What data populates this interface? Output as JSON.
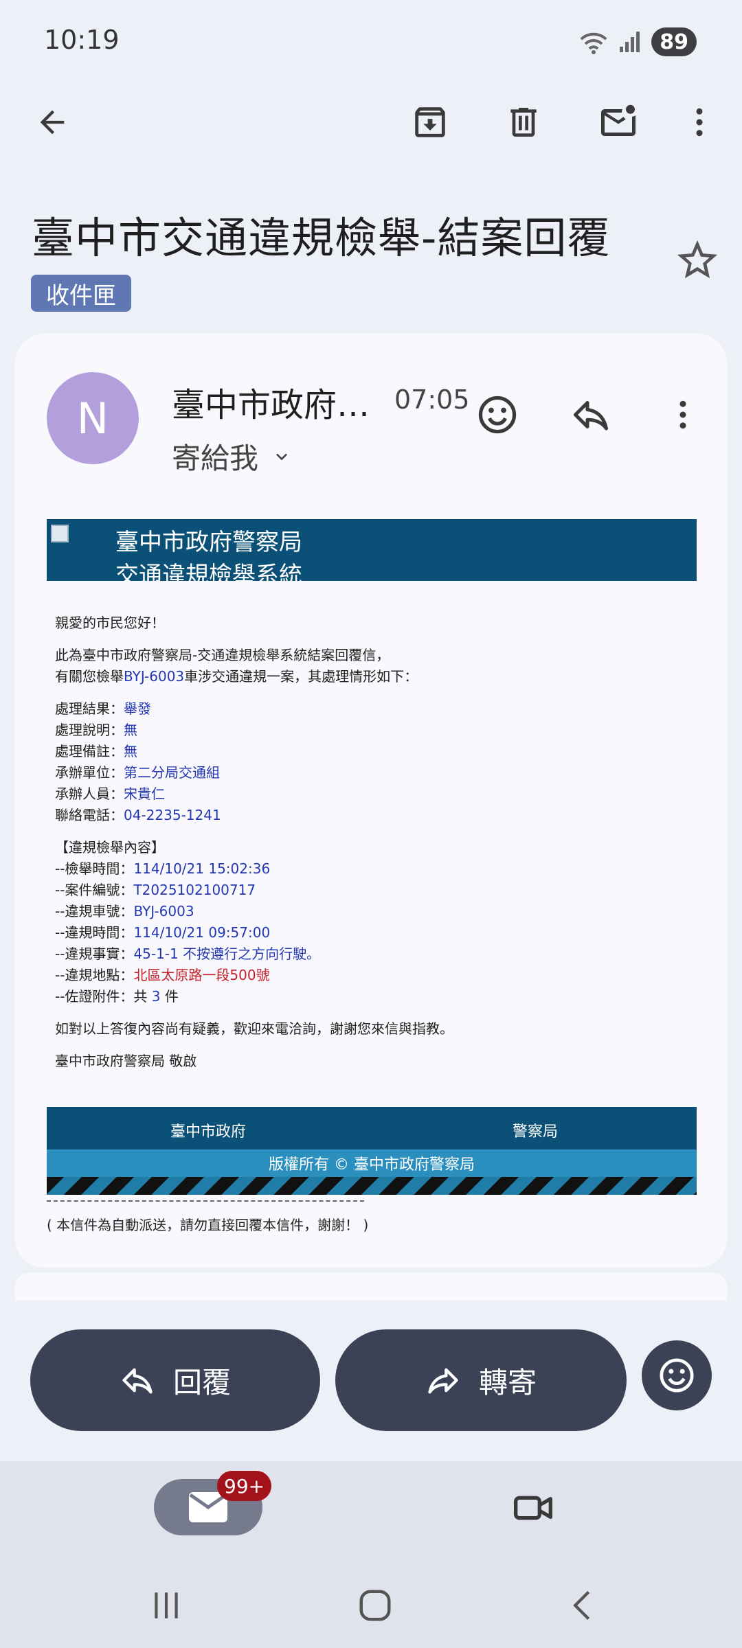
{
  "status_bar": {
    "time": "10:19",
    "battery": "89",
    "signal_label": "5"
  },
  "subject": "臺中市交通違規檢舉-結案回覆",
  "label": "收件匣",
  "message": {
    "avatar_letter": "N",
    "sender": "臺中市政府…",
    "time": "07:05",
    "to": "寄給我"
  },
  "email": {
    "header_line1": "臺中市政府警察局",
    "header_line2": "交通違規檢舉系統",
    "greeting": "親愛的市民您好！",
    "intro1": "此為臺中市政府警察局-交通違規檢舉系統結案回覆信，",
    "intro2_a": "有關您檢舉",
    "intro2_plate": "BYJ-6003",
    "intro2_b": "車涉交通違規一案，其處理情形如下：",
    "result_rows": [
      {
        "label": "處理結果：",
        "value": "舉發"
      },
      {
        "label": "處理說明：",
        "value": "無"
      },
      {
        "label": "處理備註：",
        "value": "無"
      },
      {
        "label": "承辦單位：",
        "value": "第二分局交通組"
      },
      {
        "label": "承辦人員：",
        "value": "宋貴仁"
      },
      {
        "label": "聯絡電話：",
        "value": "04-2235-1241"
      }
    ],
    "section_title": "【違規檢舉內容】",
    "detail_rows": [
      {
        "label": "--檢舉時間：",
        "value": "114/10/21 15:02:36"
      },
      {
        "label": "--案件編號：",
        "value": "T2025102100717"
      },
      {
        "label": "--違規車號：",
        "value": "BYJ-6003"
      },
      {
        "label": "--違規時間：",
        "value": "114/10/21 09:57:00"
      },
      {
        "label": "--違規事實：",
        "value": "45-1-1 不按遵行之方向行駛。"
      }
    ],
    "location_label": "--違規地點：",
    "location_value": "北區太原路一段500號",
    "attach_label": "--佐證附件：共 ",
    "attach_count": "3",
    "attach_unit": " 件",
    "closing": "如對以上答復內容尚有疑義，歡迎來電洽詢，謝謝您來信與指教。",
    "signature": "臺中市政府警察局 敬啟",
    "footer_left": "臺中市政府",
    "footer_right": "警察局",
    "copyright": "版權所有 © 臺中市政府警察局",
    "auto_note": "( 本信件為自動派送，請勿直接回覆本信件，謝謝！ )"
  },
  "actions": {
    "reply": "回覆",
    "forward": "轉寄"
  },
  "nav": {
    "mail_badge": "99+"
  }
}
